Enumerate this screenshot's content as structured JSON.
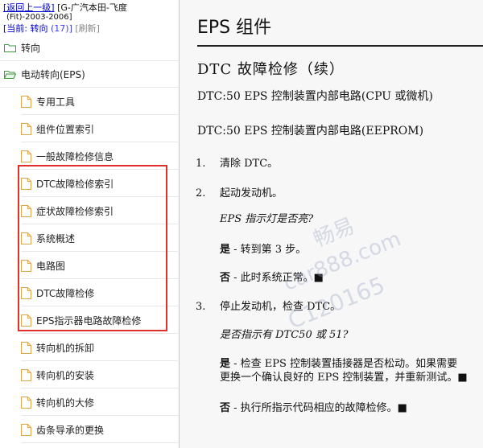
{
  "nav": {
    "back_link": "[返回上一级]",
    "vehicle": "[G-广汽本田-飞度",
    "vehicle_years": "(Fit)-2003-2006]",
    "current_label": "[当前: 转向",
    "current_count": "(17)]",
    "refresh": "[刷新]"
  },
  "tree": {
    "folders": [
      {
        "label": "转向",
        "icon": "folder-icon"
      },
      {
        "label": "电动转向(EPS)",
        "icon": "folder-open-icon"
      }
    ],
    "items": [
      {
        "label": "专用工具",
        "icon": "document-icon"
      },
      {
        "label": "组件位置索引",
        "icon": "document-icon"
      },
      {
        "label": "一般故障检修信息",
        "icon": "document-icon"
      },
      {
        "label": "DTC故障检修索引",
        "icon": "document-icon"
      },
      {
        "label": "症状故障检修索引",
        "icon": "document-icon"
      },
      {
        "label": "系统概述",
        "icon": "document-icon"
      },
      {
        "label": "电路图",
        "icon": "document-icon"
      },
      {
        "label": "DTC故障检修",
        "icon": "document-icon"
      },
      {
        "label": "EPS指示器电路故障检修",
        "icon": "document-icon"
      },
      {
        "label": "转向机的拆卸",
        "icon": "document-icon"
      },
      {
        "label": "转向机的安装",
        "icon": "document-icon"
      },
      {
        "label": "转向机的大修",
        "icon": "document-icon"
      },
      {
        "label": "齿条导承的更换",
        "icon": "document-icon"
      }
    ],
    "highlight_color": "#e0302b"
  },
  "doc": {
    "title": "EPS 组件",
    "section": "DTC 故障检修（续）",
    "dtc1": "DTC:50  EPS 控制装置内部电路(CPU 或微机)",
    "dtc2": "DTC:50  EPS 控制装置内部电路(EEPROM)",
    "steps": [
      {
        "num": "1.",
        "text": "清除 DTC。"
      },
      {
        "num": "2.",
        "text": "起动发动机。"
      },
      {
        "num": "3.",
        "text": "停止发动机，检查 DTC。"
      }
    ],
    "q1": "EPS 指示灯是否亮?",
    "q1_yes_label": "是",
    "q1_yes": " - 转到第 3 步。",
    "q1_no_label": "否",
    "q1_no": " - 此时系统正常。■",
    "q2": "是否指示有 DTC50 或 51?",
    "q2_yes_label": "是",
    "q2_yes_line1": " - 检查 EPS 控制装置插接器是否松动。如果需要",
    "q2_yes_line2": "更换一个确认良好的 EPS 控制装置，并重新测试。■",
    "q2_no_label": "否",
    "q2_no": " - 执行所指示代码相应的故障检修。■"
  },
  "watermark": {
    "brand": "畅易",
    "site": "car888.com",
    "code": "C120165"
  }
}
